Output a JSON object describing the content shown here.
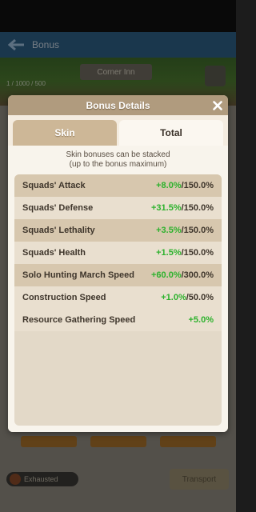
{
  "background": {
    "header_title": "Bonus",
    "location": "Corner Inn",
    "sub_label": "1 / 1000 / 500",
    "bottom_badge": "Exhausted",
    "bottom_button": "Transport"
  },
  "dialog": {
    "title": "Bonus Details",
    "close_icon": "close-icon",
    "tabs": [
      {
        "label": "Skin",
        "active": false
      },
      {
        "label": "Total",
        "active": true
      }
    ],
    "note_line1": "Skin bonuses can be stacked",
    "note_line2": "(up to the bonus maximum)",
    "bonuses": [
      {
        "name": "Squads' Attack",
        "value": "+8.0%",
        "max": "/150.0%"
      },
      {
        "name": "Squads' Defense",
        "value": "+31.5%",
        "max": "/150.0%"
      },
      {
        "name": "Squads' Lethality",
        "value": "+3.5%",
        "max": "/150.0%"
      },
      {
        "name": "Squads' Health",
        "value": "+1.5%",
        "max": "/150.0%"
      },
      {
        "name": "Solo Hunting March Speed",
        "value": "+60.0%",
        "max": "/300.0%"
      },
      {
        "name": "Construction Speed",
        "value": "+1.0%",
        "max": "/50.0%"
      },
      {
        "name": "Resource Gathering Speed",
        "value": "+5.0%",
        "max": ""
      }
    ]
  },
  "colors": {
    "bonus_green": "#2db22d",
    "header_tan": "#b09b7e",
    "panel_cream": "#f8f4ec"
  }
}
